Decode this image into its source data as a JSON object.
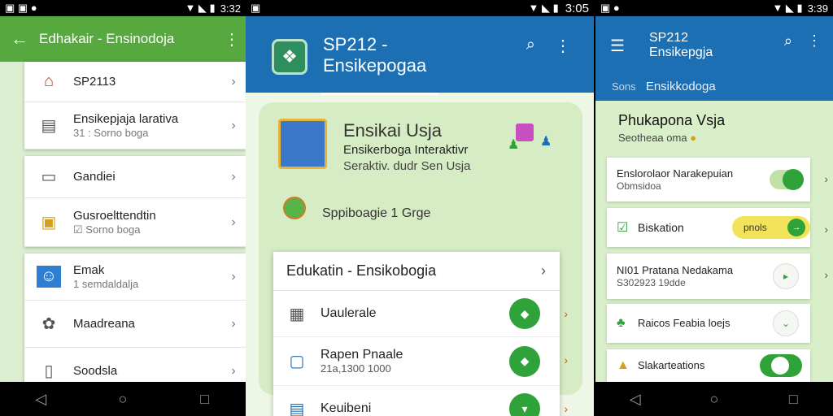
{
  "screen1": {
    "status_time": "3:32",
    "title": "Edhakair - Ensinodoja",
    "items": [
      {
        "label": "SP2113",
        "sub": ""
      },
      {
        "label": "Ensikepjaja larativa",
        "sub": "31 : Sorno boga"
      },
      {
        "label": "Gandiei",
        "sub": ""
      },
      {
        "label": "Gusroelttendtin",
        "sub": "Sorno boga"
      },
      {
        "label": "Emak",
        "sub": "1 semdaldalja"
      },
      {
        "label": "Maadreana",
        "sub": ""
      },
      {
        "label": "Soodsla",
        "sub": ""
      }
    ]
  },
  "screen2": {
    "status_time": "3:05",
    "title_line1": "SP212 -",
    "title_line2": "Ensikepogaa",
    "hero": {
      "heading": "Ensikai Usja",
      "subheading": "Ensikerboga Interaktivr",
      "desc": "Seraktiv. dudr Sen Usja",
      "mini_text": "Sppiboagie 1 Grge"
    },
    "card": {
      "title": "Edukatin - Ensikobogia",
      "rows": [
        {
          "label": "Uaulerale",
          "sub": ""
        },
        {
          "label": "Rapen Pnaale",
          "sub": "21a,1300 1000"
        },
        {
          "label": "Keuibeni",
          "sub": ""
        }
      ]
    }
  },
  "screen3": {
    "status_time": "3:39",
    "title_line1": "SP212",
    "title_line2": "Ensikepgja",
    "sub_a": "Sons",
    "sub_b": "Ensikkodoga",
    "section_title": "Phukapona Vsja",
    "section_sub": "Seotheaa oma",
    "rows": [
      {
        "label": "Enslorolaor Narakepuian",
        "sub": "Obmsidoa"
      },
      {
        "label": "Biskation",
        "pill": "pnols"
      },
      {
        "label": "NI01 Pratana Nedakama",
        "sub": "S302923 19dde"
      },
      {
        "label": "Raicos Feabia loejs",
        "sub": ""
      },
      {
        "label": "Slakarteations",
        "sub": ""
      }
    ]
  }
}
